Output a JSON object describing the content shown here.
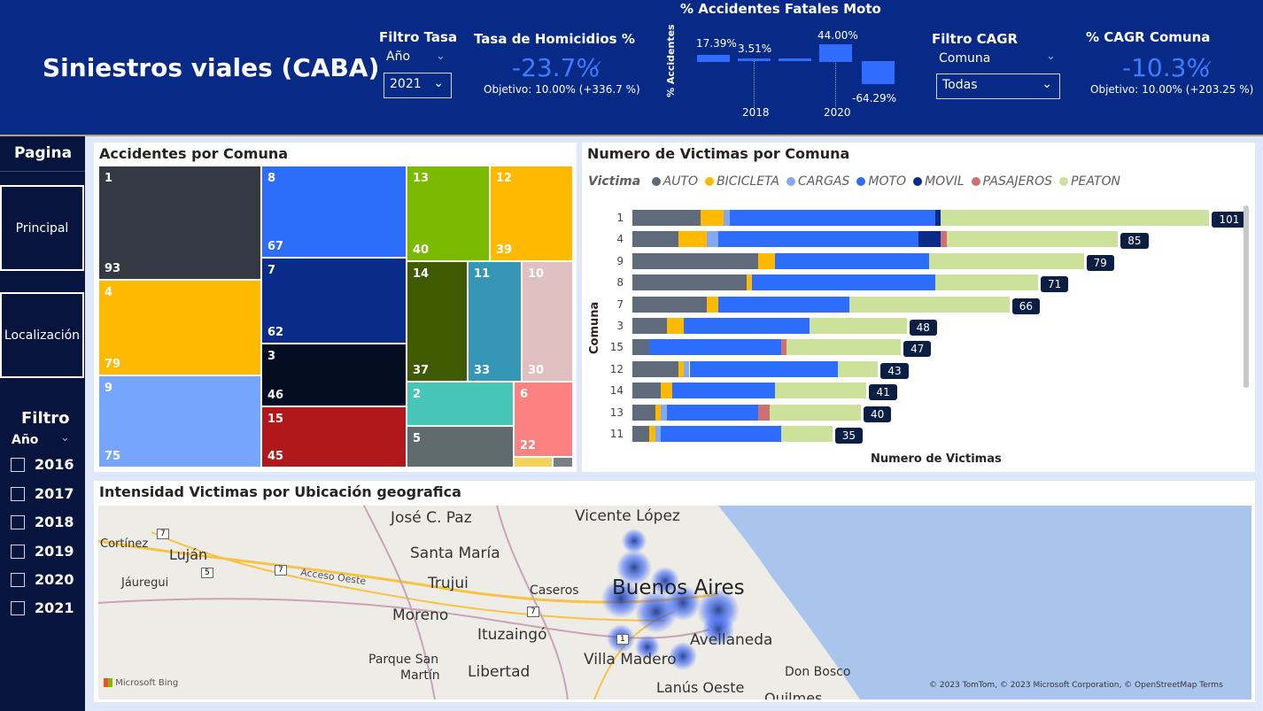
{
  "header": {
    "title": "Siniestros viales (CABA)",
    "filtro_tasa": {
      "label": "Filtro Tasa",
      "field": "Año",
      "value": "2021"
    },
    "homicidios": {
      "label": "Tasa de Homicidios %",
      "value": "-23.7%",
      "target": "Objetivo: 10.00% (+336.7 %)"
    },
    "moto": {
      "title": "% Accidentes Fatales Moto",
      "axis": "% Accidentes",
      "values": [
        "17.39%",
        "3.51%",
        "",
        "44.00%",
        "-64.29%"
      ],
      "years": [
        "2018",
        "2020"
      ]
    },
    "filtro_cagr": {
      "label": "Filtro CAGR",
      "field": "Comuna",
      "value": "Todas"
    },
    "cagr": {
      "label": "% CAGR Comuna",
      "value": "-10.3%",
      "target": "Objetivo: 10.00% (+203.25 %)"
    }
  },
  "sidebar": {
    "pagina_label": "Pagina",
    "nav": [
      "Principal",
      "Localización"
    ],
    "filtro_label": "Filtro",
    "year_field": "Año",
    "years": [
      "2016",
      "2017",
      "2018",
      "2019",
      "2020",
      "2021"
    ]
  },
  "treemap": {
    "title": "Accidentes por Comuna",
    "tiles": [
      {
        "comuna": "1",
        "value": "93",
        "color": "#333a44"
      },
      {
        "comuna": "4",
        "value": "79",
        "color": "#ffb900"
      },
      {
        "comuna": "9",
        "value": "75",
        "color": "#76a5fd"
      },
      {
        "comuna": "8",
        "value": "67",
        "color": "#2c6dfb"
      },
      {
        "comuna": "7",
        "value": "62",
        "color": "#0a2b87"
      },
      {
        "comuna": "3",
        "value": "46",
        "color": "#030d21"
      },
      {
        "comuna": "15",
        "value": "45",
        "color": "#b0181b"
      },
      {
        "comuna": "13",
        "value": "40",
        "color": "#7bba00"
      },
      {
        "comuna": "12",
        "value": "39",
        "color": "#ffb900"
      },
      {
        "comuna": "14",
        "value": "37",
        "color": "#3f5a00"
      },
      {
        "comuna": "11",
        "value": "33",
        "color": "#3596b5"
      },
      {
        "comuna": "10",
        "value": "30",
        "color": "#dfbfbf"
      },
      {
        "comuna": "2",
        "value": "",
        "color": "#47c6b8"
      },
      {
        "comuna": "6",
        "value": "22",
        "color": "#fb8281"
      },
      {
        "comuna": "5",
        "value": "",
        "color": "#5f6b6d"
      }
    ]
  },
  "victimas": {
    "title": "Numero de Victimas por Comuna",
    "legend_title": "Victima",
    "xlabel": "Numero de Victimas",
    "ylabel": "Comuna"
  },
  "chart_data": {
    "type": "bar",
    "orientation": "horizontal",
    "stacked": true,
    "title": "Numero de Victimas por Comuna",
    "xlabel": "Numero de Victimas",
    "ylabel": "Comuna",
    "categories": [
      "1",
      "4",
      "9",
      "8",
      "7",
      "3",
      "15",
      "12",
      "14",
      "13",
      "11"
    ],
    "totals": [
      101,
      85,
      79,
      71,
      66,
      48,
      47,
      43,
      41,
      40,
      35
    ],
    "series": [
      {
        "name": "AUTO",
        "color": "#5f6b7a",
        "values": [
          12,
          8,
          22,
          20,
          13,
          6,
          3,
          8,
          5,
          4,
          3
        ]
      },
      {
        "name": "BICICLETA",
        "color": "#ffb900",
        "values": [
          4,
          5,
          3,
          1,
          2,
          3,
          0,
          1,
          2,
          1,
          1
        ]
      },
      {
        "name": "CARGAS",
        "color": "#84a9f3",
        "values": [
          1,
          2,
          0,
          0,
          0,
          0,
          0,
          1,
          0,
          1,
          1
        ]
      },
      {
        "name": "MOTO",
        "color": "#2c6dfb",
        "values": [
          36,
          35,
          27,
          32,
          23,
          22,
          23,
          26,
          18,
          16,
          21
        ]
      },
      {
        "name": "MOVIL",
        "color": "#0a2b87",
        "values": [
          1,
          4,
          0,
          0,
          0,
          0,
          0,
          0,
          0,
          0,
          0
        ]
      },
      {
        "name": "PASAJEROS",
        "color": "#d06f72",
        "values": [
          0,
          1,
          0,
          0,
          0,
          0,
          1,
          0,
          0,
          2,
          0
        ]
      },
      {
        "name": "PEATON",
        "color": "#cce29b",
        "values": [
          47,
          30,
          27,
          18,
          28,
          17,
          20,
          7,
          16,
          16,
          9
        ]
      }
    ]
  },
  "map": {
    "title": "Intensidad Victimas por Ubicación geografica",
    "labels": [
      "José C. Paz",
      "Vicente López",
      "Cortínez",
      "Luján",
      "Santa María",
      "Jáuregui",
      "Trujui",
      "Caseros",
      "Buenos Aires",
      "Moreno",
      "Ituzaingó",
      "Avellaneda",
      "Parque San",
      "Martín",
      "Libertad",
      "Villa Madero",
      "Don Bosco",
      "Lanús Oeste",
      "Quilmes",
      "Acceso Oeste"
    ],
    "shields": [
      "7",
      "5",
      "7",
      "7",
      "1"
    ],
    "bing": "Microsoft Bing",
    "attribution": "© 2023 TomTom, © 2023 Microsoft Corporation, © OpenStreetMap  Terms"
  }
}
